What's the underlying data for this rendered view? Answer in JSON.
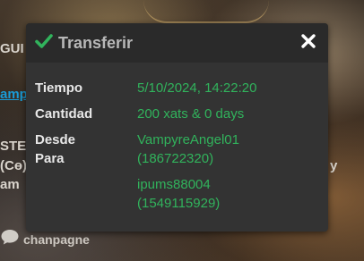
{
  "background": {
    "fragments": {
      "top_left": "GUI",
      "link": "amp",
      "mid_left": "STEI",
      "code": "(Cɵ)",
      "bottom_left": "am",
      "right_char": "y"
    },
    "footer_label": "chanpagne"
  },
  "dialog": {
    "title": "Transferir",
    "rows": {
      "time_label": "Tiempo",
      "time_value": "5/10/2024, 14:22:20",
      "amount_label": "Cantidad",
      "amount_value": "200 xats & 0 days",
      "from_label": "Desde",
      "from_name": "VampyreAngel01",
      "from_id": "(186722320)",
      "to_label": "Para",
      "to_name": "ipums88004",
      "to_id": "(1549115929)"
    }
  },
  "colors": {
    "accent_green": "#31b35c",
    "dialog_bg": "#333333",
    "header_bg": "#2a2a2a"
  },
  "icons": {
    "title_icon": "check-icon",
    "close_icon": "close-icon",
    "footer_icon": "chat-bubble-icon"
  }
}
